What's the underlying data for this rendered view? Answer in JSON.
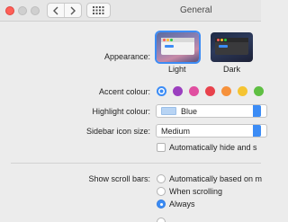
{
  "window": {
    "title": "General"
  },
  "appearance": {
    "label": "Appearance:",
    "options": [
      {
        "name": "Light",
        "selected": true
      },
      {
        "name": "Dark",
        "selected": false
      }
    ]
  },
  "accent": {
    "label": "Accent colour:",
    "colors": [
      "#3c8cf5",
      "#9b3fbf",
      "#e04fa0",
      "#e8424c",
      "#f6913b",
      "#f5c432",
      "#5fbf43"
    ],
    "selected_index": 0
  },
  "highlight": {
    "label": "Highlight colour:",
    "value": "Blue",
    "swatch_color": "#b8d4f4"
  },
  "sidebar": {
    "label": "Sidebar icon size:",
    "value": "Medium",
    "auto_hide_label": "Automatically hide and s"
  },
  "scroll_bars": {
    "label": "Show scroll bars:",
    "options": [
      {
        "text": "Automatically based on m",
        "selected": false
      },
      {
        "text": "When scrolling",
        "selected": false
      },
      {
        "text": "Always",
        "selected": true
      }
    ]
  }
}
